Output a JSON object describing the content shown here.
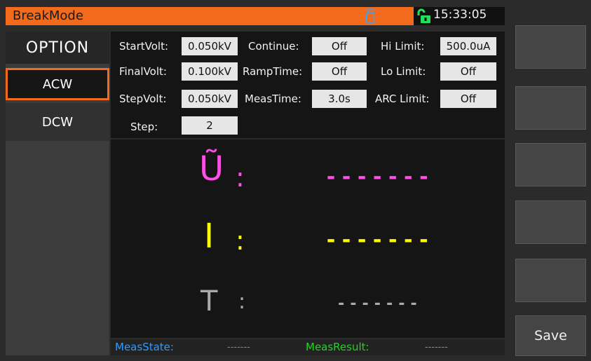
{
  "title": "BreakMode",
  "clock": "15:33:05",
  "menu": {
    "header": "OPTION",
    "items": [
      {
        "label": "ACW",
        "selected": true
      },
      {
        "label": "DCW",
        "selected": false
      }
    ]
  },
  "params": {
    "start_volt": {
      "label": "StartVolt:",
      "value": "0.050kV"
    },
    "final_volt": {
      "label": "FinalVolt:",
      "value": "0.100kV"
    },
    "step_volt": {
      "label": "StepVolt:",
      "value": "0.050kV"
    },
    "step": {
      "label": "Step:",
      "value": "2"
    },
    "continue": {
      "label": "Continue:",
      "value": "Off"
    },
    "ramp_time": {
      "label": "RampTime:",
      "value": "Off"
    },
    "meas_time": {
      "label": "MeasTime:",
      "value": "3.0s"
    },
    "hi_limit": {
      "label": "Hi Limit:",
      "value": "500.0uA"
    },
    "lo_limit": {
      "label": "Lo Limit:",
      "value": "Off"
    },
    "arc_limit": {
      "label": "ARC Limit:",
      "value": "Off"
    }
  },
  "readings": {
    "voltage": {
      "symbol": "Ũ",
      "colon": ":",
      "value": "-------",
      "color": "#ff4fe6"
    },
    "current": {
      "symbol": "I",
      "colon": ":",
      "value": "-------",
      "color": "#ffff00"
    },
    "time": {
      "symbol": "T",
      "colon": ":",
      "value": "-------",
      "color": "#aaaaaa"
    }
  },
  "bottom": {
    "meas_state_label": "MeasState:",
    "meas_state_value": "-------",
    "meas_result_label": "MeasResult:",
    "meas_result_value": "-------",
    "state_color": "#2e9bff",
    "result_color": "#22d322"
  },
  "softkeys": [
    "",
    "",
    "",
    "",
    "",
    "Save"
  ],
  "colors": {
    "accent": "#f26a1b",
    "usb_icon": "#3aa3ff",
    "lock_icon": "#22e05a"
  },
  "icons": {
    "usb": "usb-icon",
    "lock": "unlock-icon"
  }
}
